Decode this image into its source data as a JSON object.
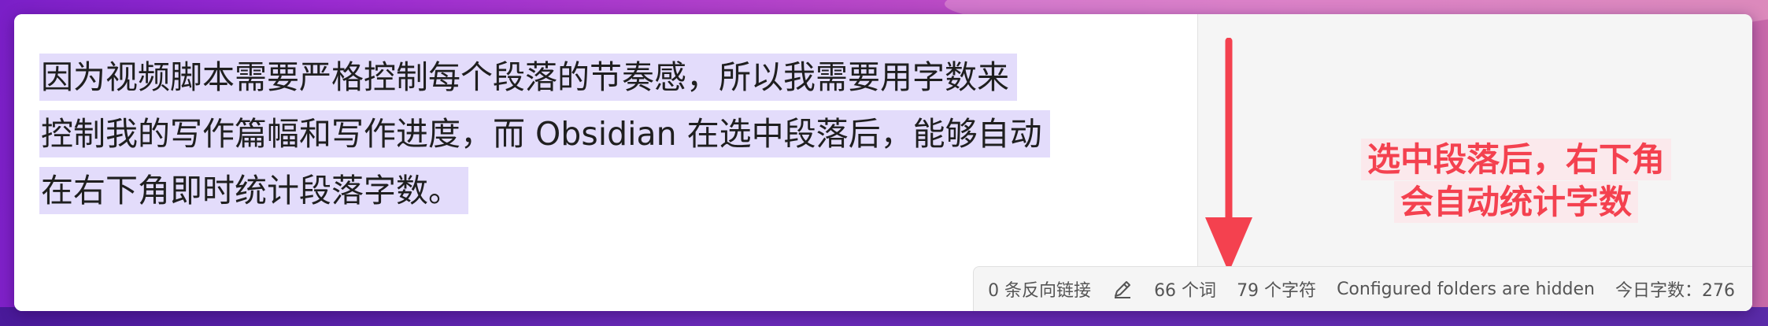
{
  "editor": {
    "paragraph_lines": [
      "因为视频脚本需要严格控制每个段落的节奏感，所以我需要用字数来",
      "控制我的写作篇幅和写作进度，而 Obsidian 在选中段落后，能够自动",
      "在右下角即时统计段落字数。"
    ]
  },
  "annotation": {
    "lines": [
      "选中段落后，右下角",
      "会自动统计字数"
    ],
    "color": "#f4414f"
  },
  "status_bar": {
    "backlinks": "0 条反向链接",
    "edit_icon": "pencil-icon",
    "words": "66 个词",
    "chars": "79 个字符",
    "folders": "Configured folders are hidden",
    "today_count": "今日字数：276"
  },
  "colors": {
    "selection": "#e3dcfb",
    "arrow": "#f4414f"
  }
}
